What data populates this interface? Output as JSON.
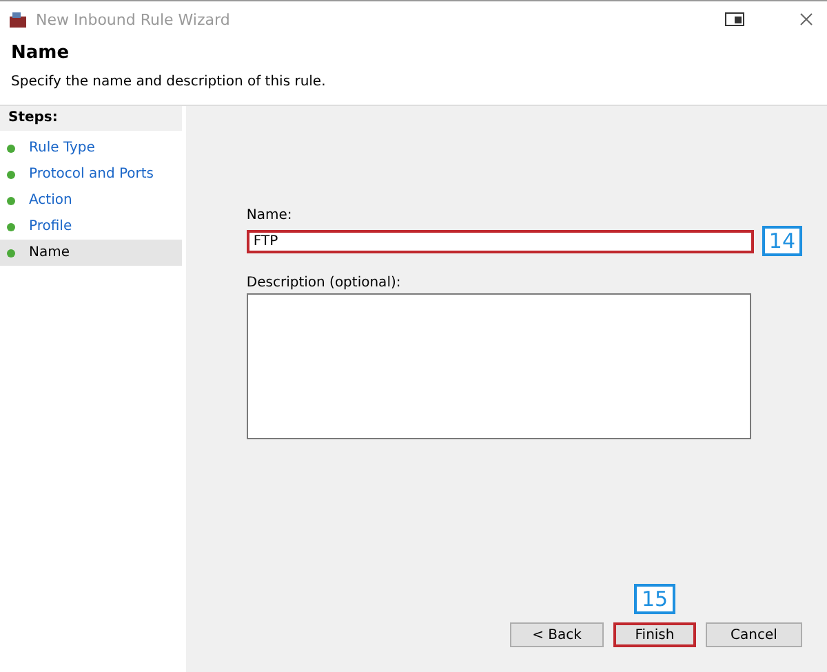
{
  "window": {
    "title": "New Inbound Rule Wizard"
  },
  "header": {
    "title": "Name",
    "subtitle": "Specify the name and description of this rule."
  },
  "steps": {
    "heading": "Steps:",
    "items": [
      {
        "label": "Rule Type",
        "selected": false
      },
      {
        "label": "Protocol and Ports",
        "selected": false
      },
      {
        "label": "Action",
        "selected": false
      },
      {
        "label": "Profile",
        "selected": false
      },
      {
        "label": "Name",
        "selected": true
      }
    ]
  },
  "form": {
    "name_label": "Name:",
    "name_value": "FTP",
    "name_highlighted": true,
    "name_callout": "14",
    "description_label": "Description (optional):"
  },
  "buttons": [
    {
      "label": "< Back",
      "highlighted": false
    },
    {
      "label": "Finish",
      "highlighted": true,
      "callout": "15"
    },
    {
      "label": "Cancel",
      "highlighted": false
    }
  ]
}
